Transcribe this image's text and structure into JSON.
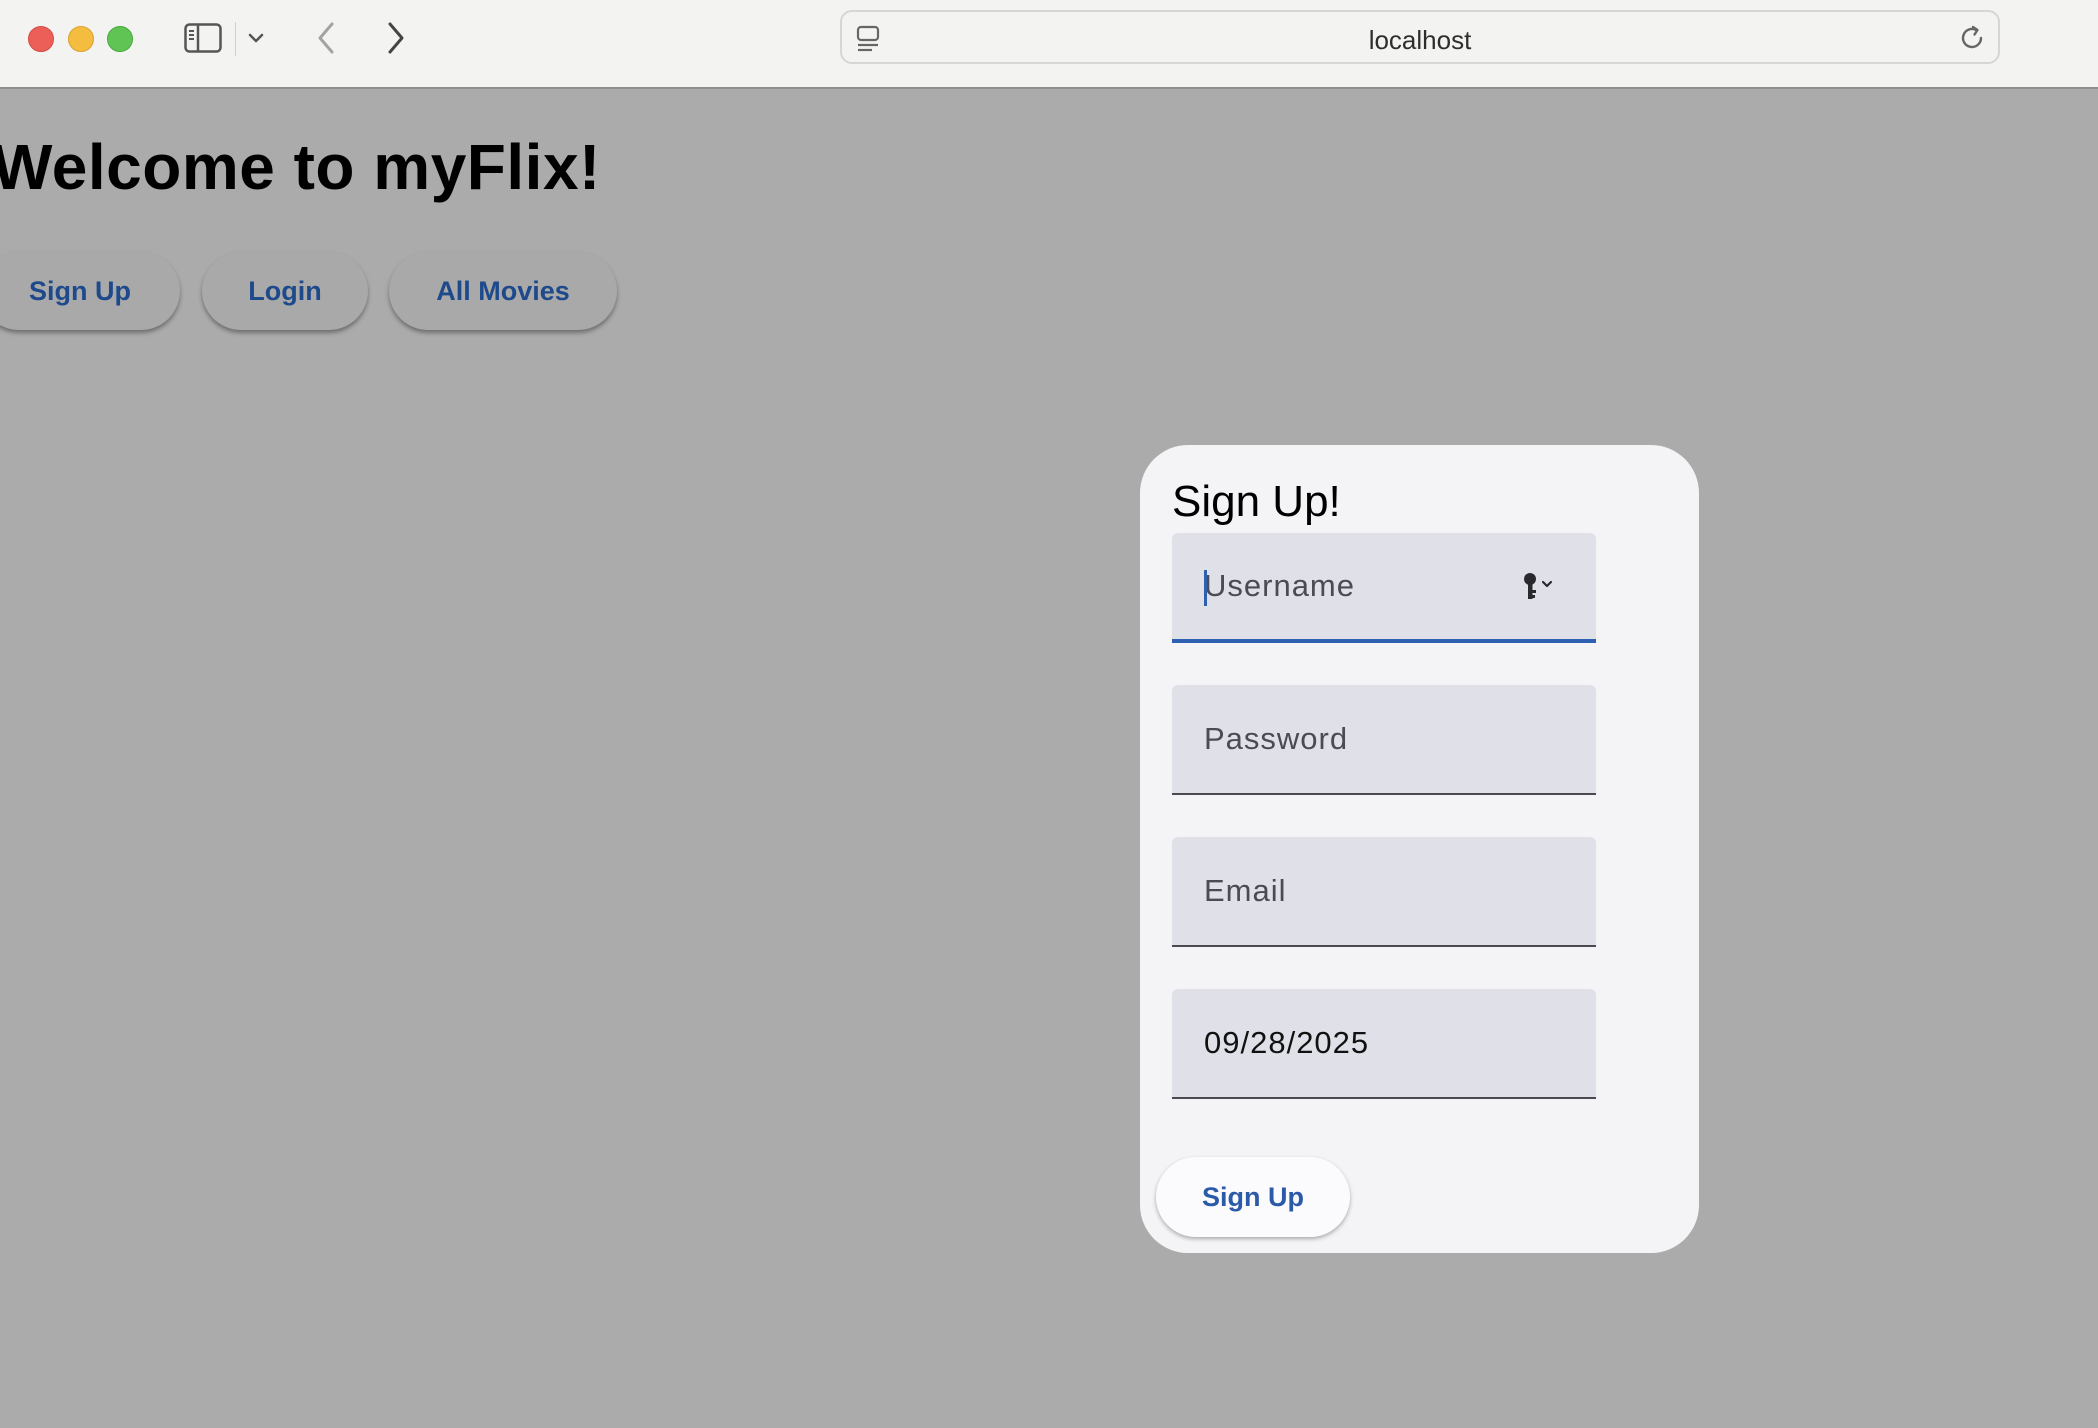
{
  "browser": {
    "url": "localhost"
  },
  "page": {
    "title": "Welcome to myFlix!",
    "nav": {
      "signup_label": "Sign Up",
      "login_label": "Login",
      "movies_label": "All Movies"
    }
  },
  "signup_form": {
    "title": "Sign Up!",
    "username": {
      "value": "",
      "placeholder": "Username"
    },
    "password": {
      "value": "",
      "placeholder": "Password"
    },
    "email": {
      "value": "",
      "placeholder": "Email"
    },
    "birthday": {
      "value": "09/28/2025"
    },
    "submit_label": "Sign Up"
  },
  "icons": {
    "window_controls": [
      "close-icon",
      "minimize-icon",
      "maximize-icon"
    ],
    "toolbar": [
      "sidebar-icon",
      "chevron-down-icon",
      "back-arrow-icon",
      "forward-arrow-icon",
      "site-info-icon",
      "reload-icon"
    ],
    "username_field": "key-icon"
  },
  "colors": {
    "page_background": "#ababab",
    "accent": "#2f5fb1",
    "nav_text": "#1e4a8c",
    "card_background": "#f4f4f6",
    "field_background": "#dfe0e8"
  }
}
